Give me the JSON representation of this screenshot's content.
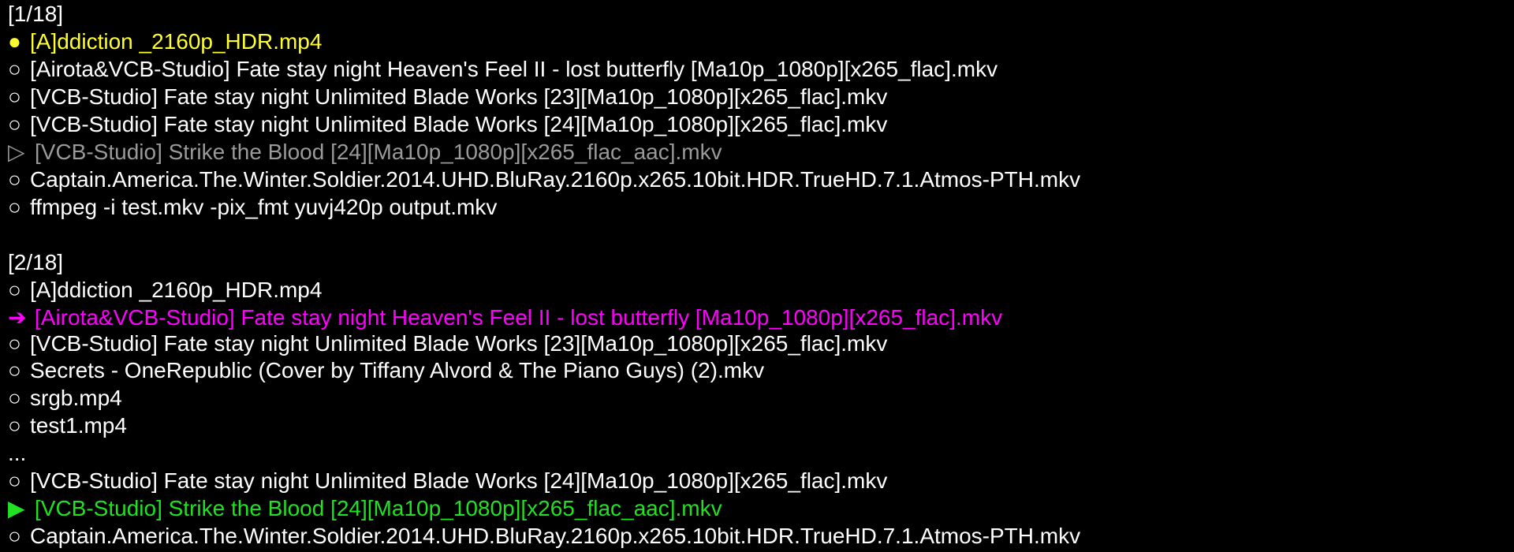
{
  "colors": {
    "background": "#000000",
    "text": "#ffffff",
    "current": "#ffff2e",
    "dim": "#9a9a9a",
    "selected": "#ff00ff",
    "playing": "#22e022"
  },
  "panel1": {
    "header": "[1/18]",
    "items": [
      {
        "marker": "●",
        "marker_icon": "filled-circle",
        "text": "[A]ddiction _2160p_HDR.mp4",
        "state": "current"
      },
      {
        "marker": "○",
        "marker_icon": "hollow-circle",
        "text": "[Airota&VCB-Studio] Fate stay night Heaven's Feel II - lost butterfly [Ma10p_1080p][x265_flac].mkv",
        "state": "normal"
      },
      {
        "marker": "○",
        "marker_icon": "hollow-circle",
        "text": "[VCB-Studio] Fate stay night Unlimited Blade Works [23][Ma10p_1080p][x265_flac].mkv",
        "state": "normal"
      },
      {
        "marker": "○",
        "marker_icon": "hollow-circle",
        "text": "[VCB-Studio] Fate stay night Unlimited Blade Works [24][Ma10p_1080p][x265_flac].mkv",
        "state": "normal"
      },
      {
        "marker": "▷",
        "marker_icon": "hollow-triangle",
        "text": "[VCB-Studio] Strike the Blood [24][Ma10p_1080p][x265_flac_aac].mkv",
        "state": "dim"
      },
      {
        "marker": "○",
        "marker_icon": "hollow-circle",
        "text": "Captain.America.The.Winter.Soldier.2014.UHD.BluRay.2160p.x265.10bit.HDR.TrueHD.7.1.Atmos-PTH.mkv",
        "state": "normal"
      },
      {
        "marker": "○",
        "marker_icon": "hollow-circle",
        "text": "ffmpeg -i test.mkv -pix_fmt yuvj420p output.mkv",
        "state": "normal"
      }
    ]
  },
  "panel2": {
    "header": "[2/18]",
    "items_top": [
      {
        "marker": "○",
        "marker_icon": "hollow-circle",
        "text": "[A]ddiction _2160p_HDR.mp4",
        "state": "normal"
      },
      {
        "marker": "➔",
        "marker_icon": "right-arrow",
        "text": "[Airota&VCB-Studio] Fate stay night Heaven's Feel II - lost butterfly [Ma10p_1080p][x265_flac].mkv",
        "state": "selected"
      },
      {
        "marker": "○",
        "marker_icon": "hollow-circle",
        "text": "[VCB-Studio] Fate stay night Unlimited Blade Works [23][Ma10p_1080p][x265_flac].mkv",
        "state": "normal"
      }
    ],
    "items_middle": [
      {
        "marker": "○",
        "marker_icon": "hollow-circle",
        "text": "Secrets - OneRepublic (Cover by Tiffany Alvord & The Piano Guys) (2).mkv",
        "state": "normal"
      },
      {
        "marker": "○",
        "marker_icon": "hollow-circle",
        "text": "srgb.mp4",
        "state": "normal"
      },
      {
        "marker": "○",
        "marker_icon": "hollow-circle",
        "text": "test1.mp4",
        "state": "normal"
      }
    ],
    "ellipsis": "...",
    "items_bottom": [
      {
        "marker": "○",
        "marker_icon": "hollow-circle",
        "text": "[VCB-Studio] Fate stay night Unlimited Blade Works [24][Ma10p_1080p][x265_flac].mkv",
        "state": "normal"
      },
      {
        "marker": "▶",
        "marker_icon": "filled-triangle",
        "text": "[VCB-Studio] Strike the Blood [24][Ma10p_1080p][x265_flac_aac].mkv",
        "state": "playing"
      },
      {
        "marker": "○",
        "marker_icon": "hollow-circle",
        "text": "Captain.America.The.Winter.Soldier.2014.UHD.BluRay.2160p.x265.10bit.HDR.TrueHD.7.1.Atmos-PTH.mkv",
        "state": "normal"
      }
    ]
  }
}
